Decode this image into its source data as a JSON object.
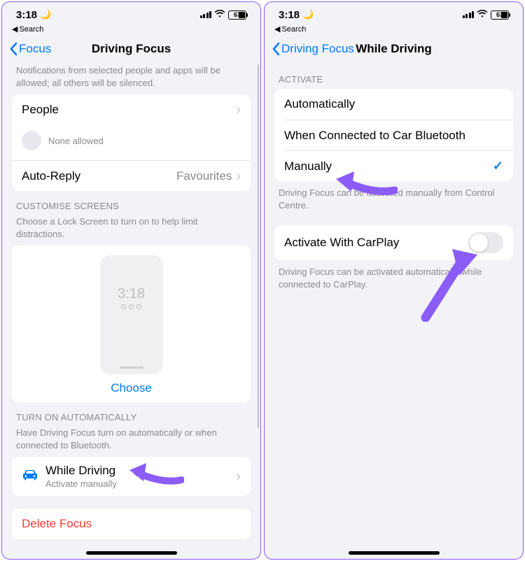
{
  "status": {
    "time": "3:18",
    "battery": "63"
  },
  "backSearch": "Search",
  "left": {
    "navBack": "Focus",
    "navTitle": "Driving Focus",
    "introDesc": "Notifications from selected people and apps will be allowed; all others will be silenced.",
    "peopleLabel": "People",
    "peopleNone": "None allowed",
    "autoReplyLabel": "Auto-Reply",
    "autoReplyValue": "Favourites",
    "customiseHeader": "CUSTOMISE SCREENS",
    "customiseDesc": "Choose a Lock Screen to turn on to help limit distractions.",
    "mockTime": "3:18",
    "chooseLabel": "Choose",
    "autoHeader": "TURN ON AUTOMATICALLY",
    "autoDesc": "Have Driving Focus turn on automatically or when connected to Bluetooth.",
    "whileDrivingLabel": "While Driving",
    "whileDrivingSub": "Activate manually",
    "deleteLabel": "Delete Focus"
  },
  "right": {
    "navBack": "Driving Focus",
    "navTitle": "While Driving",
    "activateHeader": "ACTIVATE",
    "opts": {
      "auto": "Automatically",
      "bt": "When Connected to Car Bluetooth",
      "manual": "Manually"
    },
    "activateFooter": "Driving Focus can be activated manually from Control Centre.",
    "carplayLabel": "Activate With CarPlay",
    "carplayFooter": "Driving Focus can be activated automatically while connected to CarPlay."
  }
}
